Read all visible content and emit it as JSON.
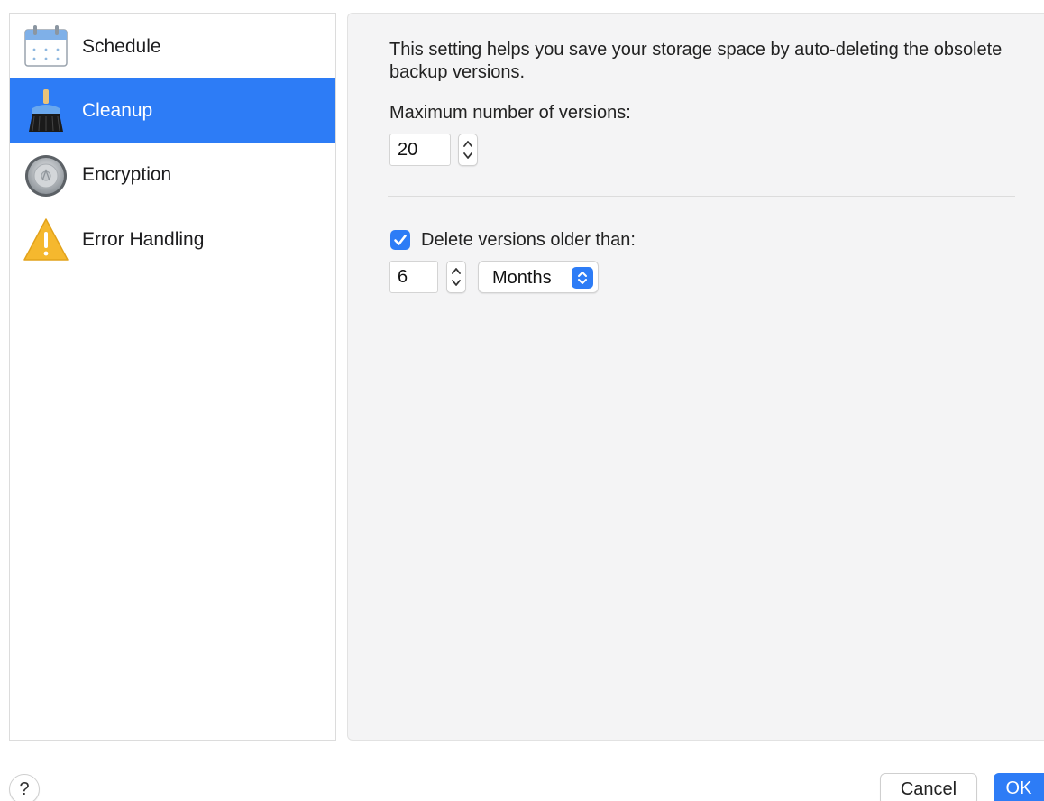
{
  "sidebar": {
    "items": [
      {
        "label": "Schedule",
        "icon": "calendar-icon",
        "selected": false
      },
      {
        "label": "Cleanup",
        "icon": "broom-icon",
        "selected": true
      },
      {
        "label": "Encryption",
        "icon": "lock-dial-icon",
        "selected": false
      },
      {
        "label": "Error Handling",
        "icon": "warning-icon",
        "selected": false
      }
    ]
  },
  "panel": {
    "description": "This setting helps you save your storage space by auto-deleting the obsolete backup versions.",
    "max_versions_label": "Maximum number of versions:",
    "max_versions_value": "20",
    "delete_older_label": "Delete versions older than:",
    "delete_older_checked": true,
    "delete_older_value": "6",
    "unit_selected": "Months"
  },
  "footer": {
    "help_label": "?",
    "cancel_label": "Cancel",
    "ok_label": "OK"
  },
  "colors": {
    "accent": "#2d7cf6",
    "panel_bg": "#f4f4f5",
    "warning": "#f5b82e"
  }
}
